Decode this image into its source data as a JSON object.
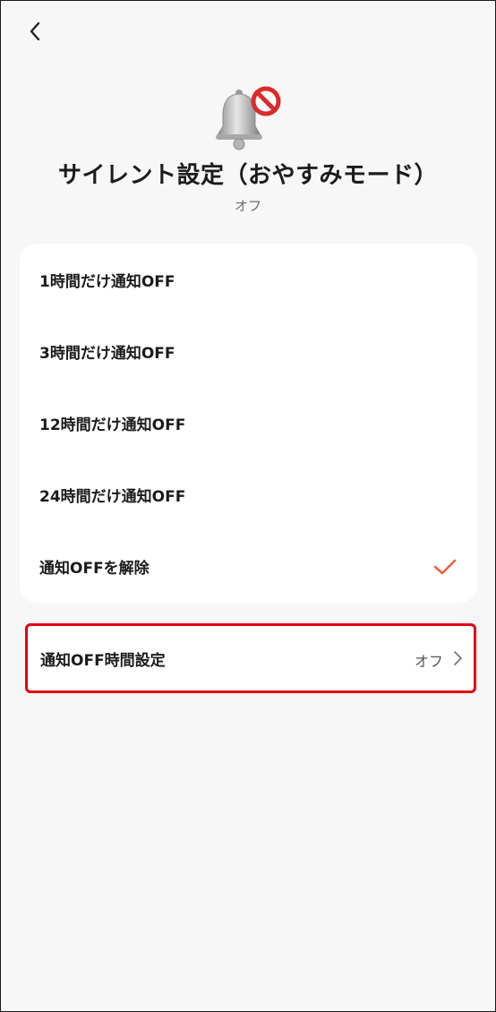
{
  "header": {
    "back_icon": "chevron-left-icon",
    "hero_icon": "bell-with-prohibition-icon"
  },
  "title": "サイレント設定（おやすみモード）",
  "status": "オフ",
  "options": [
    {
      "label": "1時間だけ通知OFF",
      "selected": false
    },
    {
      "label": "3時間だけ通知OFF",
      "selected": false
    },
    {
      "label": "12時間だけ通知OFF",
      "selected": false
    },
    {
      "label": "24時間だけ通知OFF",
      "selected": false
    },
    {
      "label": "通知OFFを解除",
      "selected": true
    }
  ],
  "time_setting": {
    "label": "通知OFF時間設定",
    "value": "オフ",
    "icon": "chevron-right-icon"
  },
  "colors": {
    "accent": "#e8643c",
    "highlight_border": "#e50012",
    "background": "#f7f7f7",
    "card": "#ffffff"
  }
}
